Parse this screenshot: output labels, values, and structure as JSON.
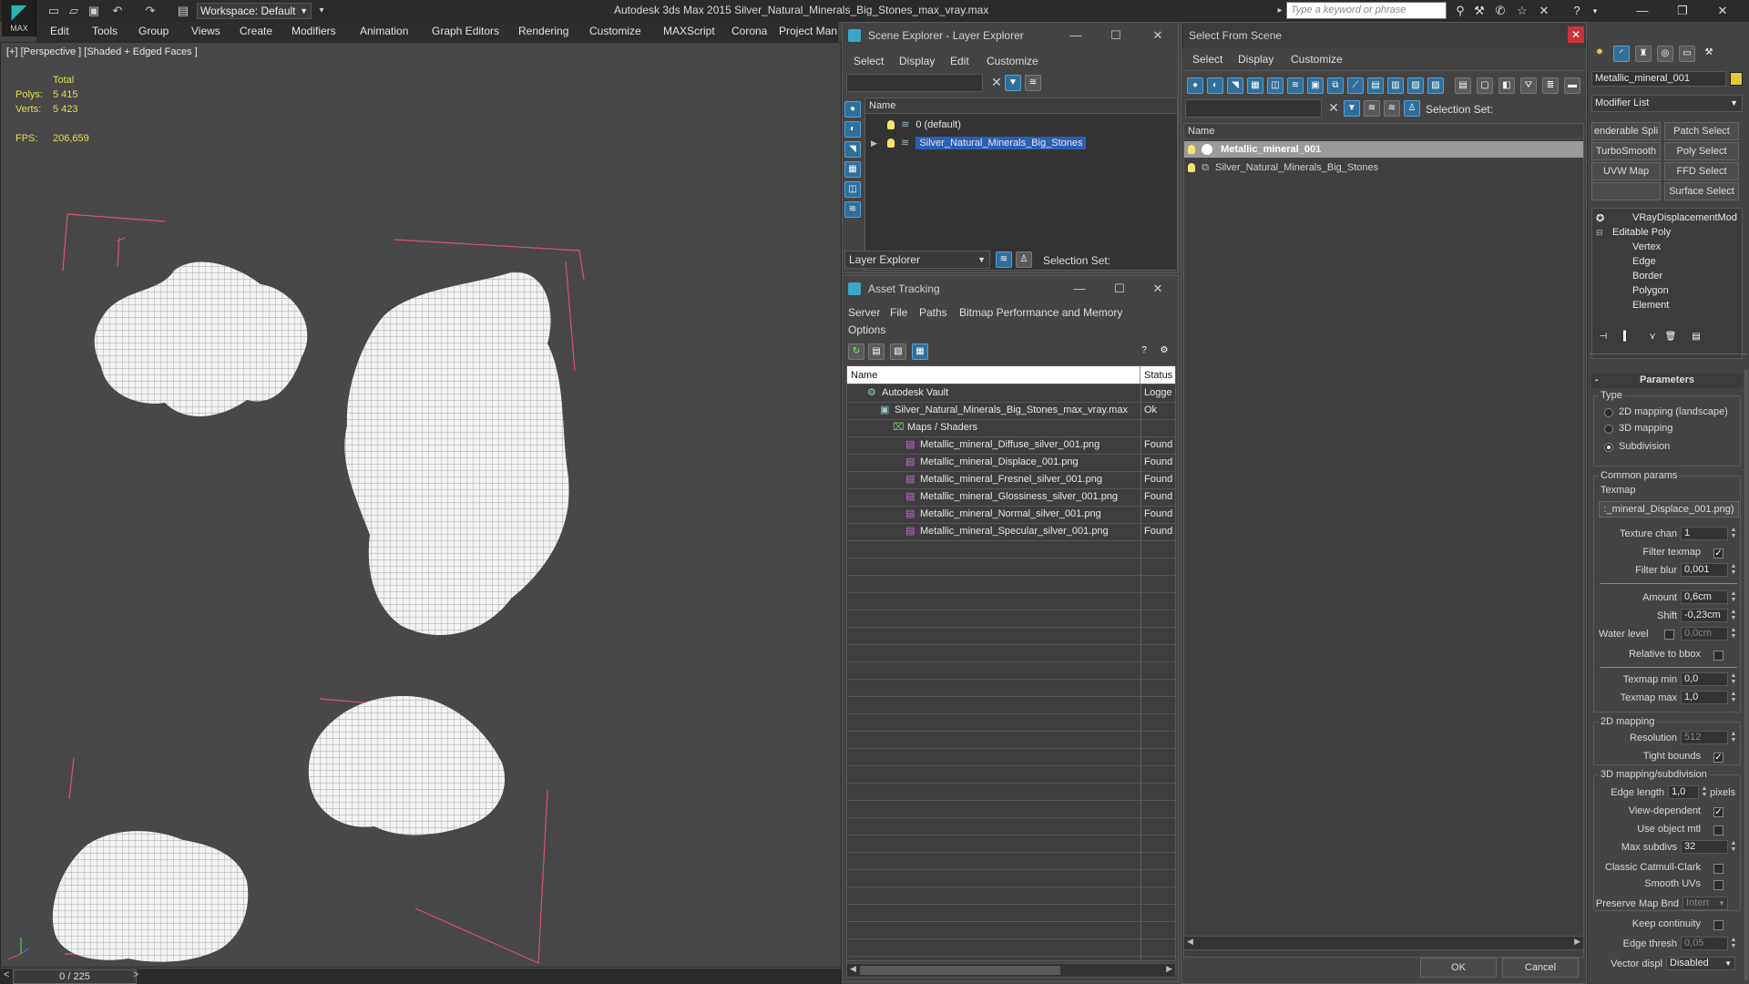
{
  "app": {
    "title": "Autodesk 3ds Max  2015     Silver_Natural_Minerals_Big_Stones_max_vray.max",
    "logo_label": "MAX",
    "workspace": "Workspace: Default",
    "search_placeholder": "Type a keyword or phrase"
  },
  "menubar": [
    "Edit",
    "Tools",
    "Group",
    "Views",
    "Create",
    "Modifiers",
    "Animation",
    "Graph Editors",
    "Rendering",
    "Customize",
    "MAXScript",
    "Corona",
    "Project Man"
  ],
  "viewport": {
    "label": "[+] [Perspective ] [Shaded + Edged Faces ]",
    "total_label": "Total",
    "polys_label": "Polys:",
    "polys_value": "5 415",
    "verts_label": "Verts:",
    "verts_value": "5 423",
    "fps_label": "FPS:",
    "fps_value": "206,659"
  },
  "timeline": {
    "frame": "0 / 225",
    "prev": "<",
    "next": ">"
  },
  "scene_explorer": {
    "title": "Scene Explorer - Layer Explorer",
    "menu": [
      "Select",
      "Display",
      "Edit",
      "Customize"
    ],
    "col_name": "Name",
    "layers": [
      {
        "name": "0 (default)",
        "selected": false
      },
      {
        "name": "Silver_Natural_Minerals_Big_Stones",
        "selected": true
      }
    ],
    "footer_dropdown": "Layer Explorer",
    "selection_set_label": "Selection Set:"
  },
  "asset_tracking": {
    "title": "Asset Tracking",
    "menu": [
      "Server",
      "File",
      "Paths",
      "Bitmap Performance and Memory",
      "Options"
    ],
    "col_name": "Name",
    "col_status": "Status",
    "rows": [
      {
        "name": "Autodesk Vault",
        "status": "Logge",
        "indent": 0
      },
      {
        "name": "Silver_Natural_Minerals_Big_Stones_max_vray.max",
        "status": "Ok",
        "indent": 1
      },
      {
        "name": "Maps / Shaders",
        "status": "",
        "indent": 2
      },
      {
        "name": "Metallic_mineral_Diffuse_silver_001.png",
        "status": "Found",
        "indent": 3
      },
      {
        "name": "Metallic_mineral_Displace_001.png",
        "status": "Found",
        "indent": 3
      },
      {
        "name": "Metallic_mineral_Fresnel_silver_001.png",
        "status": "Found",
        "indent": 3
      },
      {
        "name": "Metallic_mineral_Glossiness_silver_001.png",
        "status": "Found",
        "indent": 3
      },
      {
        "name": "Metallic_mineral_Normal_silver_001.png",
        "status": "Found",
        "indent": 3
      },
      {
        "name": "Metallic_mineral_Specular_silver_001.png",
        "status": "Found",
        "indent": 3
      }
    ]
  },
  "select_from_scene": {
    "title": "Select From Scene",
    "menu": [
      "Select",
      "Display",
      "Customize"
    ],
    "selection_set_label": "Selection Set:",
    "col_name": "Name",
    "items": [
      {
        "name": "Metallic_mineral_001",
        "selected": true
      },
      {
        "name": "Silver_Natural_Minerals_Big_Stones",
        "selected": false
      }
    ],
    "ok": "OK",
    "cancel": "Cancel"
  },
  "command_panel": {
    "object_name": "Metallic_mineral_001",
    "object_color": "#e0c83a",
    "modifier_list": "Modifier List",
    "mod_buttons": [
      "enderable Spli",
      "Patch Select",
      "TurboSmooth",
      "Poly Select",
      "UVW Map",
      "FFD Select",
      "",
      "Surface Select"
    ],
    "stack": [
      "VRayDisplacementMod",
      "Editable Poly",
      "Vertex",
      "Edge",
      "Border",
      "Polygon",
      "Element"
    ],
    "parameters_title": "Parameters",
    "type_label": "Type",
    "type_options": [
      "2D mapping (landscape)",
      "3D mapping",
      "Subdivision"
    ],
    "type_selected": 2,
    "common_label": "Common params",
    "texmap_label": "Texmap",
    "texmap_value": ":_mineral_Displace_001.png)",
    "texture_chan_label": "Texture chan",
    "texture_chan": "1",
    "filter_texmap_label": "Filter texmap",
    "filter_blur_label": "Filter blur",
    "filter_blur": "0,001",
    "amount_label": "Amount",
    "amount": "0,6cm",
    "shift_label": "Shift",
    "shift": "-0,23cm",
    "water_label": "Water level",
    "water": "0,0cm",
    "relative_label": "Relative to bbox",
    "texmin_label": "Texmap min",
    "texmin": "0,0",
    "texmax_label": "Texmap max",
    "texmax": "1,0",
    "map2d_label": "2D mapping",
    "resolution_label": "Resolution",
    "resolution": "512",
    "tight_label": "Tight bounds",
    "map3d_label": "3D mapping/subdivision",
    "edge_length_label": "Edge length",
    "edge_length": "1,0",
    "pixels_label": "pixels",
    "view_dep_label": "View-dependent",
    "use_obj_label": "Use object mtl",
    "max_subdivs_label": "Max subdivs",
    "max_subdivs": "32",
    "catmull_label": "Classic Catmull-Clark",
    "smooth_uv_label": "Smooth UVs",
    "preserve_label": "Preserve Map Bnd",
    "preserve_value": "Interr",
    "keep_cont_label": "Keep continuity",
    "edge_thresh_label": "Edge thresh",
    "edge_thresh": "0,05",
    "vector_label": "Vector displ",
    "vector_value": "Disabled"
  }
}
